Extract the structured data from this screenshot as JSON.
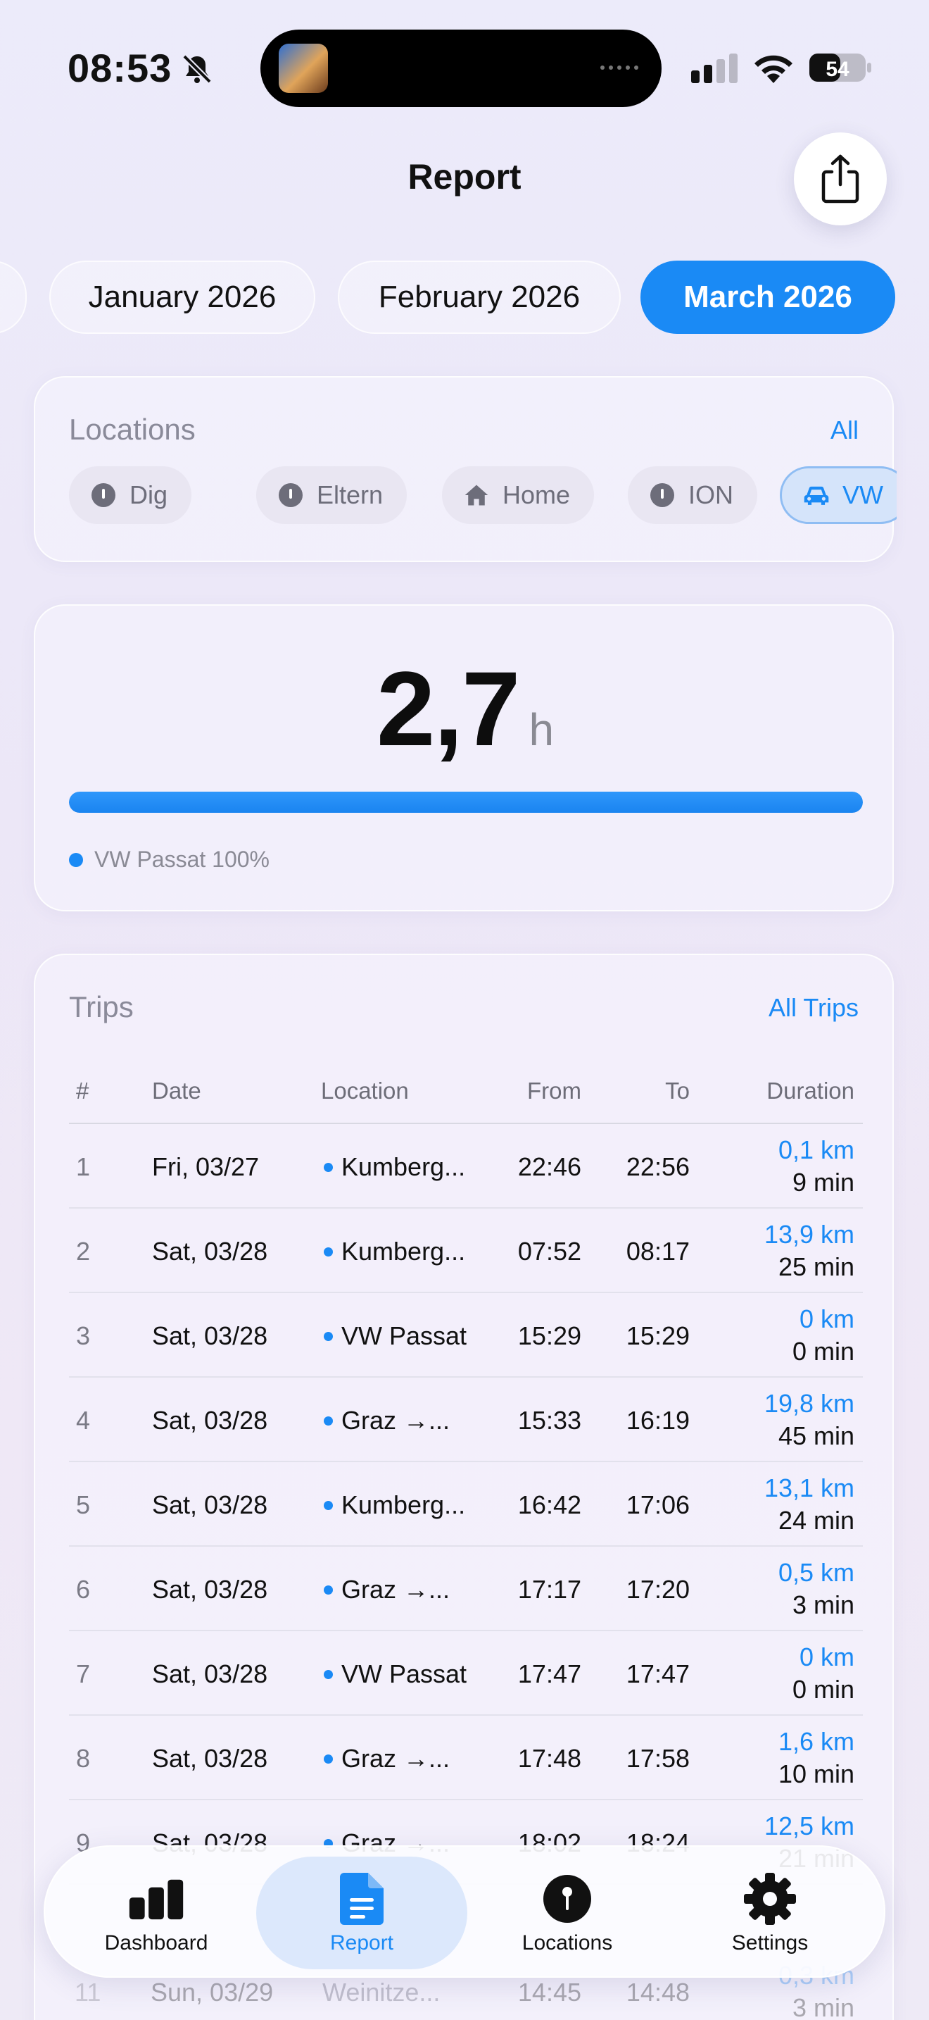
{
  "status_bar": {
    "time": "08:53",
    "battery": "54"
  },
  "header": {
    "title": "Report"
  },
  "months": [
    "January 2026",
    "February 2026",
    "March 2026"
  ],
  "locations": {
    "title": "Locations",
    "all_label": "All",
    "chips": [
      {
        "label": "Dig",
        "icon": "pin-icon"
      },
      {
        "label": "Eltern",
        "icon": "pin-icon"
      },
      {
        "label": "Home",
        "icon": "home-icon"
      },
      {
        "label": "ION",
        "icon": "pin-icon"
      },
      {
        "label": "VW",
        "icon": "car-icon",
        "active": true
      }
    ]
  },
  "summary": {
    "value": "2,7",
    "unit": "h",
    "progress_fraction": 1.0,
    "legend": "VW Passat 100%",
    "accent": "#1a8af5"
  },
  "trips": {
    "title": "Trips",
    "all_label": "All Trips",
    "columns": [
      "#",
      "Date",
      "Location",
      "From",
      "To",
      "Duration"
    ],
    "rows": [
      {
        "n": "1",
        "date": "Fri, 03/27",
        "loc": "Kumberg...",
        "from": "22:46",
        "to": "22:56",
        "km": "0,1 km",
        "min": "9 min"
      },
      {
        "n": "2",
        "date": "Sat, 03/28",
        "loc": "Kumberg...",
        "from": "07:52",
        "to": "08:17",
        "km": "13,9 km",
        "min": "25 min"
      },
      {
        "n": "3",
        "date": "Sat, 03/28",
        "loc": "VW Passat",
        "from": "15:29",
        "to": "15:29",
        "km": "0 km",
        "min": "0 min"
      },
      {
        "n": "4",
        "date": "Sat, 03/28",
        "loc": "Graz →...",
        "from": "15:33",
        "to": "16:19",
        "km": "19,8 km",
        "min": "45 min"
      },
      {
        "n": "5",
        "date": "Sat, 03/28",
        "loc": "Kumberg...",
        "from": "16:42",
        "to": "17:06",
        "km": "13,1 km",
        "min": "24 min"
      },
      {
        "n": "6",
        "date": "Sat, 03/28",
        "loc": "Graz →...",
        "from": "17:17",
        "to": "17:20",
        "km": "0,5 km",
        "min": "3 min"
      },
      {
        "n": "7",
        "date": "Sat, 03/28",
        "loc": "VW Passat",
        "from": "17:47",
        "to": "17:47",
        "km": "0 km",
        "min": "0 min"
      },
      {
        "n": "8",
        "date": "Sat, 03/28",
        "loc": "Graz →...",
        "from": "17:48",
        "to": "17:58",
        "km": "1,6 km",
        "min": "10 min"
      },
      {
        "n": "9",
        "date": "Sat, 03/28",
        "loc": "Graz →...",
        "from": "18:02",
        "to": "18:24",
        "km": "12,5 km",
        "min": "21 min"
      }
    ],
    "partial_row": {
      "n": "11",
      "date": "Sun, 03/29",
      "loc": "Weinitze...",
      "from": "14:45",
      "to": "14:48",
      "km": "0,3 km",
      "min": "3 min"
    }
  },
  "tabbar": {
    "tabs": [
      {
        "label": "Dashboard",
        "icon": "bar-chart-icon"
      },
      {
        "label": "Report",
        "icon": "document-icon",
        "active": true
      },
      {
        "label": "Locations",
        "icon": "pin-icon"
      },
      {
        "label": "Settings",
        "icon": "gear-icon"
      }
    ]
  }
}
